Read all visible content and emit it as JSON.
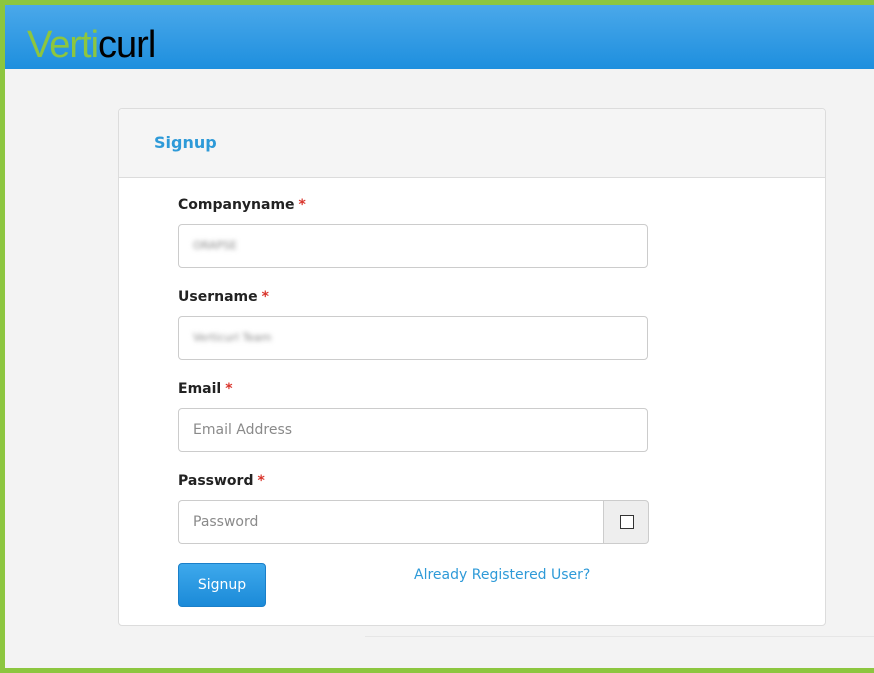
{
  "app": {
    "logo_part1": "Verti",
    "logo_part2": "curl"
  },
  "form": {
    "title": "Signup",
    "required_marker": "*",
    "fields": [
      {
        "label": "Companyname",
        "value": "ORAPSE",
        "placeholder": ""
      },
      {
        "label": "Username",
        "value": "Verticurl Team",
        "placeholder": ""
      },
      {
        "label": "Email",
        "value": "",
        "placeholder": "Email Address"
      },
      {
        "label": "Password",
        "value": "",
        "placeholder": "Password"
      }
    ],
    "show_password_checked": false,
    "submit_label": "Signup",
    "login_link": "Already Registered User?"
  },
  "colors": {
    "accent": "#2e9ad8",
    "brand_green": "#8dc63f",
    "required": "#d9342b"
  }
}
